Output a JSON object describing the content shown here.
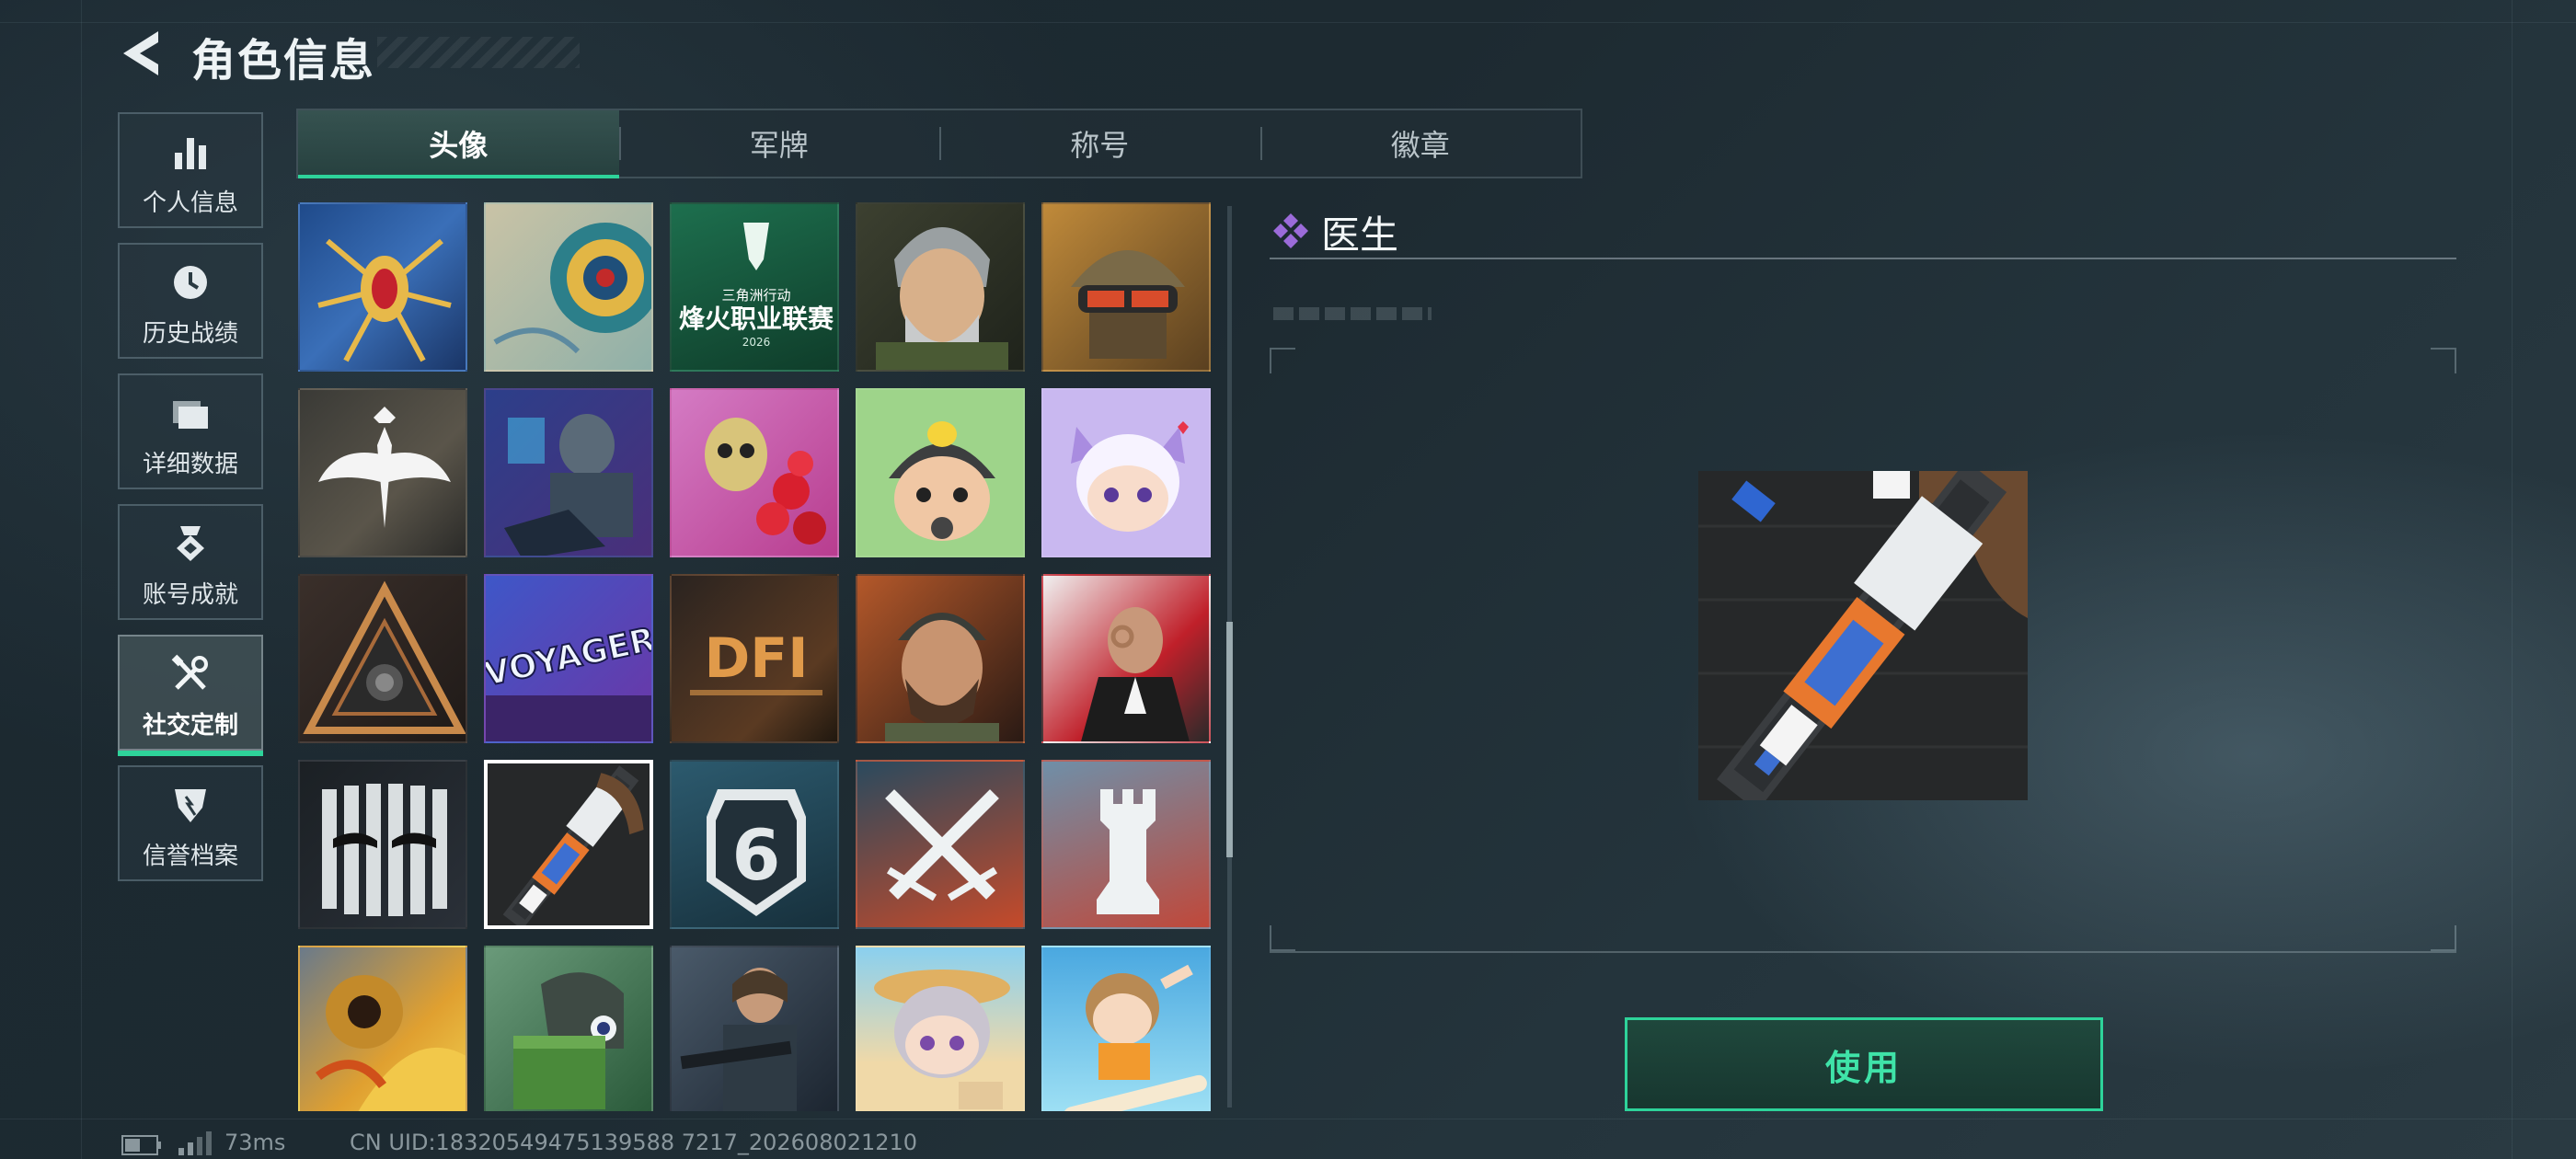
{
  "header": {
    "title": "角色信息",
    "back_icon": "back-arrow-icon"
  },
  "sidebar": {
    "items": [
      {
        "label": "个人信息",
        "icon": "bar-chart-icon",
        "active": false
      },
      {
        "label": "历史战绩",
        "icon": "history-clock-icon",
        "active": false
      },
      {
        "label": "详细数据",
        "icon": "folder-icon",
        "active": false
      },
      {
        "label": "账号成就",
        "icon": "achievement-medal-icon",
        "active": false
      },
      {
        "label": "社交定制",
        "icon": "tools-icon",
        "active": true
      },
      {
        "label": "信誉档案",
        "icon": "reputation-badge-icon",
        "active": false
      }
    ]
  },
  "tabs": [
    {
      "label": "头像",
      "active": true
    },
    {
      "label": "军牌",
      "active": false
    },
    {
      "label": "称号",
      "active": false
    },
    {
      "label": "徽章",
      "active": false
    }
  ],
  "avatars": {
    "selected_index": 16,
    "items": [
      {
        "icon": "golden-spider-jewel-avatar"
      },
      {
        "icon": "mandala-ornament-avatar"
      },
      {
        "icon": "esports-league-logo-avatar",
        "caption": "烽火职业联赛",
        "sub_caption": "三角洲行动",
        "year": "2026"
      },
      {
        "icon": "old-soldier-portrait-avatar"
      },
      {
        "icon": "helmet-goggles-soldier-avatar"
      },
      {
        "icon": "white-eagle-emblem-avatar"
      },
      {
        "icon": "hacker-laptop-avatar"
      },
      {
        "icon": "skull-roses-avatar"
      },
      {
        "icon": "chibi-duck-helmet-avatar"
      },
      {
        "icon": "chibi-cat-girl-avatar"
      },
      {
        "icon": "triangle-emblem-avatar"
      },
      {
        "icon": "voyager-graffiti-avatar",
        "caption": "VOYAGER"
      },
      {
        "icon": "dfi-logo-avatar",
        "caption": "DFI"
      },
      {
        "icon": "bearded-soldier-avatar"
      },
      {
        "icon": "suit-man-ok-sign-avatar"
      },
      {
        "icon": "striped-mask-avatar"
      },
      {
        "icon": "medic-syringe-gun-avatar"
      },
      {
        "icon": "badge-six-avatar",
        "caption": "6"
      },
      {
        "icon": "crossed-swords-avatar"
      },
      {
        "icon": "rook-chess-avatar"
      },
      {
        "icon": "golden-armor-fire-avatar"
      },
      {
        "icon": "green-box-soldier-avatar"
      },
      {
        "icon": "female-operator-avatar"
      },
      {
        "icon": "chibi-beach-girl-avatar"
      },
      {
        "icon": "chibi-surfer-avatar"
      }
    ]
  },
  "detail": {
    "name": "医生",
    "rarity_icon": "purple-diamond-icon",
    "rarity_color": "#9b6bd9",
    "preview_icon": "medic-syringe-gun-avatar",
    "use_label": "使用"
  },
  "status": {
    "ping": "73ms",
    "uid": "CN UID:18320549475139588 7217_202608021210"
  },
  "colors": {
    "accent": "#2ed39a",
    "background": "#1d2a31"
  }
}
